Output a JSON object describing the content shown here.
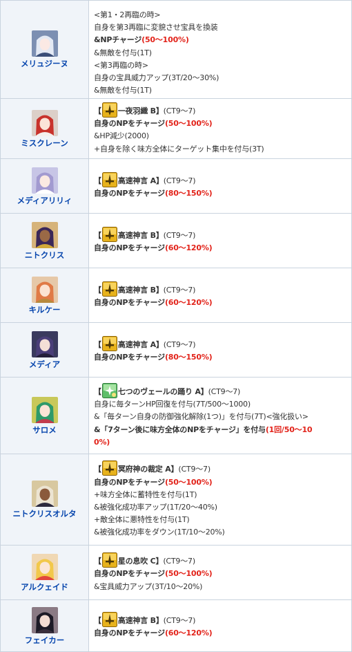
{
  "rows": [
    {
      "name": "メリュジーヌ",
      "colors": {
        "bg": "#7c8fb2",
        "hair": "#e3e9f4",
        "face": "#fbe9e4",
        "cloth": "#3a4e78"
      },
      "lines": [
        [
          {
            "t": "<第1・2再臨の時>"
          }
        ],
        [
          {
            "t": "自身を第3再臨に変貌させ宝具を換装"
          }
        ],
        [
          {
            "t": "&NPチャージ",
            "s": "b"
          },
          {
            "t": "(50～100%)",
            "s": "r"
          }
        ],
        [
          {
            "t": "&無敵を付与(1T)"
          }
        ],
        [
          {
            "t": "<第3再臨の時>"
          }
        ],
        [
          {
            "t": "自身の宝具威力アップ(3T/20～30%)"
          }
        ],
        [
          {
            "t": "&無敵を付与(1T)"
          }
        ]
      ]
    },
    {
      "name": "ミスクレーン",
      "colors": {
        "bg": "#dccfc8",
        "hair": "#c8322c",
        "face": "#fbe4d8",
        "cloth": "#f4f0ee"
      },
      "lines": [
        [
          {
            "t": "【",
            "s": "sn"
          },
          {
            "icon": "gold"
          },
          {
            "t": "一夜羽織 B】",
            "s": "sn"
          },
          {
            "t": "(CT9～7)"
          }
        ],
        [
          {
            "t": "自身のNPをチャージ",
            "s": "b"
          },
          {
            "t": "(50～100%)",
            "s": "r"
          }
        ],
        [
          {
            "t": "&HP減少(2000)"
          }
        ],
        [
          {
            "t": "+自身を除く味方全体にターゲット集中を付与(3T)"
          }
        ]
      ]
    },
    {
      "name": "メディアリリィ",
      "colors": {
        "bg": "#c7c5e6",
        "hair": "#a29ad0",
        "face": "#fbeae2",
        "cloth": "#ffffff"
      },
      "lines": [
        [
          {
            "t": "【",
            "s": "sn"
          },
          {
            "icon": "gold"
          },
          {
            "t": "高速神言 A】",
            "s": "sn"
          },
          {
            "t": "(CT9～7)"
          }
        ],
        [
          {
            "t": "自身のNPをチャージ",
            "s": "b"
          },
          {
            "t": "(80～150%)",
            "s": "r"
          }
        ]
      ]
    },
    {
      "name": "ニトクリス",
      "colors": {
        "bg": "#d6b37a",
        "hair": "#3a2758",
        "face": "#9a6946",
        "cloth": "#d2a93a"
      },
      "lines": [
        [
          {
            "t": "【",
            "s": "sn"
          },
          {
            "icon": "gold"
          },
          {
            "t": "高速神言 B】",
            "s": "sn"
          },
          {
            "t": "(CT9～7)"
          }
        ],
        [
          {
            "t": "自身のNPをチャージ",
            "s": "b"
          },
          {
            "t": "(60～120%)",
            "s": "r"
          }
        ]
      ]
    },
    {
      "name": "キルケー",
      "colors": {
        "bg": "#e6c8a8",
        "hair": "#e07a46",
        "face": "#fbe3d2",
        "cloth": "#b78a3d"
      },
      "lines": [
        [
          {
            "t": "【",
            "s": "sn"
          },
          {
            "icon": "gold"
          },
          {
            "t": "高速神言 B】",
            "s": "sn"
          },
          {
            "t": "(CT9～7)"
          }
        ],
        [
          {
            "t": "自身のNPをチャージ",
            "s": "b"
          },
          {
            "t": "(60～120%)",
            "s": "r"
          }
        ]
      ]
    },
    {
      "name": "メディア",
      "colors": {
        "bg": "#3a3a5e",
        "hair": "#4a3e78",
        "face": "#f4dfd6",
        "cloth": "#241f3a"
      },
      "lines": [
        [
          {
            "t": "【",
            "s": "sn"
          },
          {
            "icon": "gold"
          },
          {
            "t": "高速神言 A】",
            "s": "sn"
          },
          {
            "t": "(CT9～7)"
          }
        ],
        [
          {
            "t": "自身のNPをチャージ",
            "s": "b"
          },
          {
            "t": "(80～150%)",
            "s": "r"
          }
        ]
      ]
    },
    {
      "name": "サロメ",
      "colors": {
        "bg": "#c8c85a",
        "hair": "#2e9a6a",
        "face": "#fbe4d6",
        "cloth": "#c23c4c"
      },
      "lines": [
        [
          {
            "t": "【",
            "s": "sn"
          },
          {
            "icon": "green"
          },
          {
            "t": "七つのヴェールの踊り A】",
            "s": "sn"
          },
          {
            "t": "(CT9～7)"
          }
        ],
        [
          {
            "t": "自身に毎ターンHP回復を付与(7T/500～1000)"
          }
        ],
        [
          {
            "t": "&「毎ターン自身の防御強化解除(1つ)」を付与(7T)<強化扱い>"
          }
        ],
        [
          {
            "t": "&「7ターン後に味方全体のNPをチャージ」を付与",
            "s": "b"
          },
          {
            "t": "(1回/50～10",
            "s": "r"
          }
        ],
        [
          {
            "t": "0%)",
            "s": "r"
          }
        ]
      ]
    },
    {
      "name": "ニトクリスオルタ",
      "colors": {
        "bg": "#d8c8a0",
        "hair": "#ece4d2",
        "face": "#8a5a3c",
        "cloth": "#2c2a3e"
      },
      "lines": [
        [
          {
            "t": "【",
            "s": "sn"
          },
          {
            "icon": "gold"
          },
          {
            "t": "冥府神の裁定 A】",
            "s": "sn"
          },
          {
            "t": "(CT9～7)"
          }
        ],
        [
          {
            "t": "自身のNPをチャージ",
            "s": "b"
          },
          {
            "t": "(50～100%)",
            "s": "r"
          }
        ],
        [
          {
            "t": "+味方全体に蓄特性を付与(1T)"
          }
        ],
        [
          {
            "t": "&被強化成功率アップ(1T/20～40%)"
          }
        ],
        [
          {
            "t": "+敵全体に悪特性を付与(1T)"
          }
        ],
        [
          {
            "t": "&被強化成功率をダウン(1T/10～20%)"
          }
        ]
      ]
    },
    {
      "name": "アルクェイド",
      "colors": {
        "bg": "#f0d8b4",
        "hair": "#f2c84a",
        "face": "#fbe6d6",
        "cloth": "#e2463c"
      },
      "lines": [
        [
          {
            "t": "【",
            "s": "sn"
          },
          {
            "icon": "gold"
          },
          {
            "t": "星の息吹 C】",
            "s": "sn"
          },
          {
            "t": "(CT9～7)"
          }
        ],
        [
          {
            "t": "自身のNPをチャージ",
            "s": "b"
          },
          {
            "t": "(50～100%)",
            "s": "r"
          }
        ],
        [
          {
            "t": "&宝具威力アップ(3T/10～20%)"
          }
        ]
      ]
    },
    {
      "name": "フェイカー",
      "colors": {
        "bg": "#8a7a84",
        "hair": "#1c1a26",
        "face": "#f2dcd2",
        "cloth": "#3a2f3c"
      },
      "lines": [
        [
          {
            "t": "【",
            "s": "sn"
          },
          {
            "icon": "gold"
          },
          {
            "t": "高速神言 B】",
            "s": "sn"
          },
          {
            "t": "(CT9～7)"
          }
        ],
        [
          {
            "t": "自身のNPをチャージ",
            "s": "b"
          },
          {
            "t": "(60～120%)",
            "s": "r"
          }
        ]
      ]
    }
  ]
}
